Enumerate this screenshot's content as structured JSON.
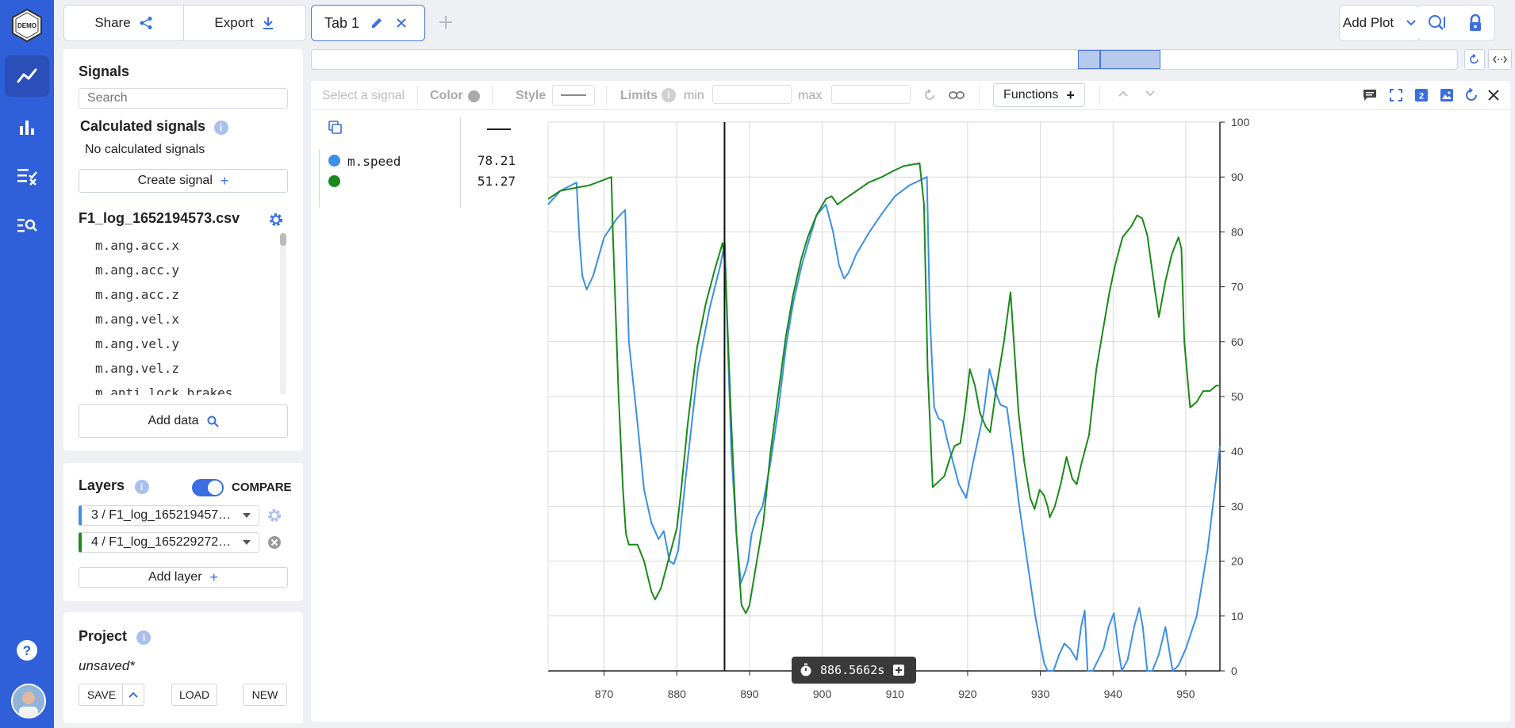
{
  "toolbar": {
    "share_label": "Share",
    "export_label": "Export",
    "tab_label": "Tab 1",
    "add_plot_label": "Add Plot"
  },
  "logo_text": "DEMO",
  "signals": {
    "title": "Signals",
    "search_placeholder": "Search",
    "calc_title": "Calculated signals",
    "calc_empty": "No calculated signals",
    "create_label": "Create signal",
    "file_name": "F1_log_1652194573.csv",
    "items": [
      "m.ang.acc.x",
      "m.ang.acc.y",
      "m.ang.acc.z",
      "m.ang.vel.x",
      "m.ang.vel.y",
      "m.ang.vel.z",
      "m.anti_lock_brakes"
    ],
    "add_data_label": "Add data"
  },
  "layers": {
    "title": "Layers",
    "compare_label": "COMPARE",
    "items": [
      {
        "label": "3 / F1_log_165219457…",
        "color": "#3b8fe8"
      },
      {
        "label": "4 / F1_log_165229272…",
        "color": "#1a8a1a"
      }
    ],
    "add_label": "Add layer"
  },
  "project": {
    "title": "Project",
    "status": "unsaved*",
    "save_label": "SAVE",
    "load_label": "LOAD",
    "new_label": "NEW"
  },
  "plot_toolbar": {
    "select_placeholder": "Select a signal",
    "color_label": "Color",
    "style_label": "Style",
    "limits_label": "Limits",
    "min_label": "min",
    "max_label": "max",
    "functions_label": "Functions"
  },
  "legend": {
    "rows": [
      {
        "name": "m.speed",
        "value": "78.21",
        "color": "#3b8fe8"
      },
      {
        "name": "",
        "value": "51.27",
        "color": "#1a8a1a"
      }
    ]
  },
  "cursor": {
    "label": "886.5662s",
    "x": 886.5662
  },
  "colors": {
    "accent": "#2f5fd9",
    "blue_series": "#3b8fe8",
    "green_series": "#1a8a1a"
  },
  "chart_data": {
    "type": "line",
    "xlabel": "",
    "ylabel": "",
    "xlim": [
      862.3,
      954.7
    ],
    "ylim": [
      0,
      100
    ],
    "x_ticks": [
      "870",
      "880",
      "890",
      "900",
      "910",
      "920",
      "930",
      "940",
      "950"
    ],
    "y_ticks": [
      "0",
      "10",
      "20",
      "30",
      "40",
      "50",
      "60",
      "70",
      "80",
      "90",
      "100"
    ],
    "grid": true,
    "series": [
      {
        "name": "m.speed",
        "color": "#3b8fe8",
        "points": [
          [
            862.3,
            85
          ],
          [
            864,
            87.5
          ],
          [
            866.2,
            89
          ],
          [
            866.6,
            79
          ],
          [
            867,
            72
          ],
          [
            867.6,
            69.5
          ],
          [
            868.5,
            72
          ],
          [
            870,
            79
          ],
          [
            871.8,
            82.5
          ],
          [
            872.9,
            84
          ],
          [
            873.4,
            60
          ],
          [
            874.6,
            45
          ],
          [
            875.5,
            33
          ],
          [
            876.5,
            27
          ],
          [
            877.5,
            24
          ],
          [
            878.2,
            25.5
          ],
          [
            879,
            20
          ],
          [
            879.6,
            19.5
          ],
          [
            880.2,
            22
          ],
          [
            881.2,
            35
          ],
          [
            882.9,
            55
          ],
          [
            884.5,
            66
          ],
          [
            886,
            74
          ],
          [
            886.6,
            78
          ],
          [
            887,
            60
          ],
          [
            887.5,
            40
          ],
          [
            888.2,
            25
          ],
          [
            888.8,
            16
          ],
          [
            889.4,
            18
          ],
          [
            889.8,
            20
          ],
          [
            890.3,
            25
          ],
          [
            891,
            28
          ],
          [
            891.8,
            30
          ],
          [
            892.9,
            38
          ],
          [
            894,
            48
          ],
          [
            895,
            59
          ],
          [
            896,
            67
          ],
          [
            897.2,
            74
          ],
          [
            898.3,
            79
          ],
          [
            899.2,
            83
          ],
          [
            900.5,
            85
          ],
          [
            901.5,
            80
          ],
          [
            902.3,
            74
          ],
          [
            903,
            71.5
          ],
          [
            903.6,
            72.5
          ],
          [
            904.7,
            76
          ],
          [
            906.5,
            80
          ],
          [
            908.3,
            83.5
          ],
          [
            910,
            86.5
          ],
          [
            912,
            88.5
          ],
          [
            914.4,
            90
          ],
          [
            914.8,
            65
          ],
          [
            915.4,
            48
          ],
          [
            916,
            46
          ],
          [
            916.6,
            45.5
          ],
          [
            917.2,
            42
          ],
          [
            918,
            38
          ],
          [
            918.8,
            34
          ],
          [
            919.8,
            31.5
          ],
          [
            920.6,
            37
          ],
          [
            921.4,
            42
          ],
          [
            922.2,
            47
          ],
          [
            923,
            55
          ],
          [
            923.8,
            51
          ],
          [
            924.5,
            48.5
          ],
          [
            925.4,
            48
          ],
          [
            926.2,
            40
          ],
          [
            927,
            31
          ],
          [
            928.2,
            20
          ],
          [
            929.3,
            10
          ],
          [
            930,
            5
          ],
          [
            930.5,
            1.5
          ],
          [
            931,
            0
          ],
          [
            931.8,
            0
          ],
          [
            932.6,
            3
          ],
          [
            933.3,
            5
          ],
          [
            934.1,
            4
          ],
          [
            935,
            2
          ],
          [
            935.6,
            8
          ],
          [
            936.1,
            11
          ],
          [
            936.5,
            0
          ],
          [
            937.2,
            0
          ],
          [
            938.7,
            4
          ],
          [
            939.4,
            8
          ],
          [
            940.1,
            10.5
          ],
          [
            940.7,
            4
          ],
          [
            941.2,
            0
          ],
          [
            942,
            2
          ],
          [
            942.9,
            8
          ],
          [
            943.6,
            11.5
          ],
          [
            944.1,
            8
          ],
          [
            944.7,
            0
          ],
          [
            945.4,
            0
          ],
          [
            946.3,
            3
          ],
          [
            947.2,
            8
          ],
          [
            947.7,
            4
          ],
          [
            948.2,
            0
          ],
          [
            949,
            1
          ],
          [
            950,
            4
          ],
          [
            951.5,
            10
          ],
          [
            953,
            22
          ],
          [
            954.7,
            41
          ]
        ]
      },
      {
        "name": "",
        "color": "#1a8a1a",
        "points": [
          [
            862.3,
            86
          ],
          [
            864,
            87.5
          ],
          [
            866,
            88
          ],
          [
            868,
            88.5
          ],
          [
            870,
            89.5
          ],
          [
            871,
            90
          ],
          [
            871.2,
            80
          ],
          [
            872,
            50
          ],
          [
            872.6,
            33
          ],
          [
            873,
            25
          ],
          [
            873.4,
            23
          ],
          [
            874.6,
            23
          ],
          [
            875.5,
            20
          ],
          [
            876.5,
            14.5
          ],
          [
            877,
            13
          ],
          [
            877.8,
            15
          ],
          [
            879,
            21
          ],
          [
            880,
            26
          ],
          [
            880.6,
            33
          ],
          [
            881.5,
            45
          ],
          [
            882.8,
            59
          ],
          [
            884,
            67
          ],
          [
            885.2,
            73
          ],
          [
            886.3,
            78
          ],
          [
            886.7,
            73
          ],
          [
            887,
            62
          ],
          [
            887.5,
            45
          ],
          [
            888.2,
            25
          ],
          [
            888.9,
            12
          ],
          [
            889.5,
            10.5
          ],
          [
            890,
            12
          ],
          [
            891,
            20
          ],
          [
            891.9,
            27
          ],
          [
            892.9,
            40
          ],
          [
            894,
            51
          ],
          [
            895,
            61
          ],
          [
            896,
            68.5
          ],
          [
            897.1,
            75
          ],
          [
            898,
            79
          ],
          [
            899.2,
            83
          ],
          [
            900.5,
            86
          ],
          [
            901.3,
            86.5
          ],
          [
            902.1,
            85
          ],
          [
            903.1,
            86
          ],
          [
            904.2,
            87
          ],
          [
            906.4,
            89
          ],
          [
            908.2,
            90
          ],
          [
            909.6,
            91
          ],
          [
            911.2,
            92
          ],
          [
            913.4,
            92.5
          ],
          [
            914,
            85
          ],
          [
            914.5,
            55
          ],
          [
            915.2,
            33.5
          ],
          [
            916,
            34.5
          ],
          [
            916.8,
            35.5
          ],
          [
            917.5,
            38.5
          ],
          [
            918.2,
            41
          ],
          [
            919,
            41.5
          ],
          [
            919.6,
            47
          ],
          [
            920.3,
            55
          ],
          [
            921,
            52
          ],
          [
            921.7,
            47
          ],
          [
            922.5,
            44.5
          ],
          [
            923.1,
            43.5
          ],
          [
            924,
            52
          ],
          [
            925,
            60
          ],
          [
            925.9,
            69
          ],
          [
            926.3,
            61
          ],
          [
            927,
            47
          ],
          [
            927.8,
            38
          ],
          [
            928.6,
            31.5
          ],
          [
            929.2,
            29.5
          ],
          [
            929.9,
            33
          ],
          [
            930.5,
            32
          ],
          [
            931,
            30
          ],
          [
            931.3,
            28
          ],
          [
            932,
            30
          ],
          [
            932.8,
            34
          ],
          [
            933.6,
            39
          ],
          [
            934.4,
            35
          ],
          [
            935,
            34
          ],
          [
            935.7,
            38
          ],
          [
            936.7,
            43
          ],
          [
            937.7,
            55
          ],
          [
            938.6,
            62
          ],
          [
            939.5,
            69
          ],
          [
            940.3,
            74
          ],
          [
            941.3,
            79
          ],
          [
            942.5,
            81
          ],
          [
            943.3,
            83
          ],
          [
            944,
            82.5
          ],
          [
            944.7,
            79.5
          ],
          [
            945.8,
            69
          ],
          [
            946.3,
            64.5
          ],
          [
            947.2,
            71
          ],
          [
            948.1,
            76
          ],
          [
            949,
            79
          ],
          [
            949.4,
            77
          ],
          [
            949.8,
            60
          ],
          [
            950.6,
            48
          ],
          [
            951.5,
            49
          ],
          [
            952.4,
            51
          ],
          [
            953.3,
            51
          ],
          [
            954.2,
            52
          ],
          [
            954.7,
            52
          ]
        ]
      }
    ]
  }
}
